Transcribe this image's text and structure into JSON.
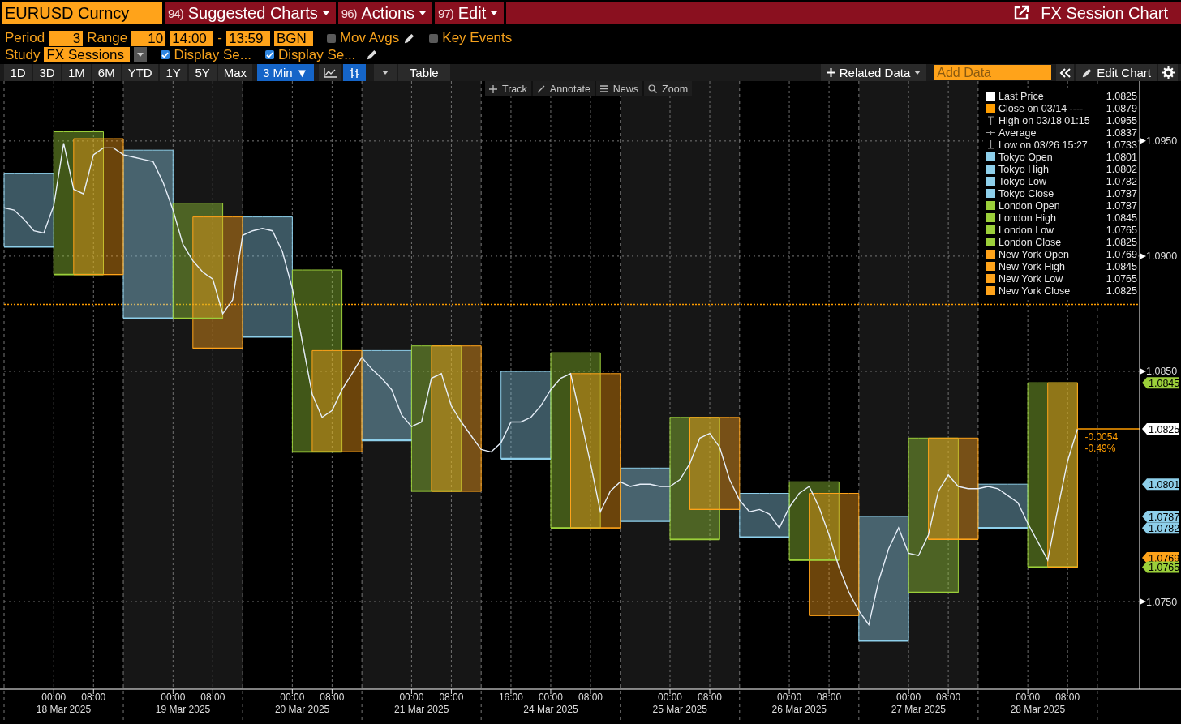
{
  "header": {
    "security": "EURUSD Curncy",
    "menus": [
      {
        "number": "94)",
        "label": "Suggested Charts"
      },
      {
        "number": "96)",
        "label": "Actions"
      },
      {
        "number": "97)",
        "label": "Edit"
      }
    ],
    "title": "FX Session Chart"
  },
  "settings": {
    "period_label": "Period",
    "period": "3",
    "range_label": "Range",
    "range": "10",
    "start": "14:00",
    "separator": "-",
    "end": "13:59",
    "mode": "BGN",
    "options": [
      {
        "kind": "editable",
        "label": "Mov Avgs",
        "checked": false
      },
      {
        "kind": "plain",
        "label": "Key Events",
        "checked": false
      }
    ]
  },
  "study": {
    "label": "Study",
    "value": "FX Sessions",
    "options": [
      {
        "label": "Display Se...",
        "checked": true
      },
      {
        "label": "Display Se...",
        "checked": true
      }
    ]
  },
  "toolbar": {
    "ranges": [
      {
        "label": "1D",
        "selected": false
      },
      {
        "label": "3D",
        "selected": false
      },
      {
        "label": "1M",
        "selected": false
      },
      {
        "label": "6M",
        "selected": false
      },
      {
        "label": "YTD",
        "selected": false
      },
      {
        "label": "1Y",
        "selected": false
      },
      {
        "label": "5Y",
        "selected": false
      },
      {
        "label": "Max",
        "selected": false
      }
    ],
    "frequency": "3 Min ▼",
    "chart_types": [
      {
        "kind": "line",
        "selected": false
      },
      {
        "kind": "bar",
        "selected": true
      }
    ],
    "table": "Table",
    "related": "Related Data",
    "add_data_placeholder": "Add Data",
    "edit_chart": "Edit Chart"
  },
  "chart_tools": [
    {
      "kind": "track",
      "label": "Track"
    },
    {
      "kind": "annotate",
      "label": "Annotate"
    },
    {
      "kind": "news",
      "label": "News"
    },
    {
      "kind": "zoom",
      "label": "Zoom"
    }
  ],
  "legend": [
    {
      "kind": "square",
      "label": "Last Price",
      "value": "1.0825",
      "color": "#ffffff"
    },
    {
      "kind": "square",
      "label": "Close on 03/14 ----",
      "value": "1.0879",
      "color": "#ff9d00"
    },
    {
      "kind": "high",
      "label": "High on 03/18 01:15",
      "value": "1.0955"
    },
    {
      "kind": "average",
      "label": "Average",
      "value": "1.0837"
    },
    {
      "kind": "low",
      "label": "Low on 03/26 15:27",
      "value": "1.0733"
    },
    {
      "kind": "square",
      "label": "Tokyo Open",
      "value": "1.0801",
      "color": "#8ecfea"
    },
    {
      "kind": "square",
      "label": "Tokyo High",
      "value": "1.0802",
      "color": "#8ecfea"
    },
    {
      "kind": "square",
      "label": "Tokyo Low",
      "value": "1.0782",
      "color": "#8ecfea"
    },
    {
      "kind": "square",
      "label": "Tokyo Close",
      "value": "1.0787",
      "color": "#8ecfea"
    },
    {
      "kind": "square",
      "label": "London Open",
      "value": "1.0787",
      "color": "#9bcf3a"
    },
    {
      "kind": "square",
      "label": "London High",
      "value": "1.0845",
      "color": "#9bcf3a"
    },
    {
      "kind": "square",
      "label": "London Low",
      "value": "1.0765",
      "color": "#9bcf3a"
    },
    {
      "kind": "square",
      "label": "London Close",
      "value": "1.0825",
      "color": "#9bcf3a"
    },
    {
      "kind": "square",
      "label": "New York Open",
      "value": "1.0769",
      "color": "#ffa31a"
    },
    {
      "kind": "square",
      "label": "New York High",
      "value": "1.0845",
      "color": "#ffa31a"
    },
    {
      "kind": "square",
      "label": "New York Low",
      "value": "1.0765",
      "color": "#ffa31a"
    },
    {
      "kind": "square",
      "label": "New York Close",
      "value": "1.0825",
      "color": "#ffa31a"
    }
  ],
  "chart": {
    "dates": [
      {
        "label": "18 Mar 2025",
        "shaded": false
      },
      {
        "label": "19 Mar 2025",
        "shaded": true
      },
      {
        "label": "20 Mar 2025",
        "shaded": false
      },
      {
        "label": "21 Mar 2025",
        "shaded": true
      },
      {
        "label": "24 Mar 2025",
        "shaded": false
      },
      {
        "label": "25 Mar 2025",
        "shaded": true
      },
      {
        "label": "26 Mar 2025",
        "shaded": false
      },
      {
        "label": "27 Mar 2025",
        "shaded": true
      },
      {
        "label": "28 Mar 2025",
        "shaded": false
      }
    ],
    "chart_data": {
      "type": "line",
      "grid": true,
      "ylim": [
        1.0712,
        1.0976
      ],
      "yticks": [
        {
          "value": 1.075,
          "label": "1.0750"
        },
        {
          "value": 1.085,
          "label": "1.0850"
        },
        {
          "value": 1.09,
          "label": "1.0900"
        },
        {
          "value": 1.095,
          "label": "1.0950"
        }
      ],
      "categories": [
        null,
        null,
        null,
        null,
        null,
        "00:00",
        null,
        null,
        null,
        "08:00",
        null,
        null,
        null,
        null,
        null,
        null,
        null,
        "00:00",
        null,
        null,
        null,
        "08:00",
        null,
        null,
        null,
        null,
        null,
        null,
        null,
        "00:00",
        null,
        null,
        null,
        "08:00",
        null,
        null,
        null,
        null,
        null,
        null,
        null,
        "00:00",
        null,
        null,
        null,
        "08:00",
        null,
        null,
        null,
        null,
        null,
        "16:00",
        null,
        null,
        null,
        "00:00",
        null,
        null,
        null,
        "08:00",
        null,
        null,
        null,
        null,
        null,
        null,
        null,
        "00:00",
        null,
        null,
        null,
        "08:00",
        null,
        null,
        null,
        null,
        null,
        null,
        null,
        "00:00",
        null,
        null,
        null,
        "08:00",
        null,
        null,
        null,
        null,
        null,
        null,
        null,
        "00:00",
        null,
        null,
        null,
        "08:00",
        null,
        null,
        null,
        null,
        null,
        null,
        null,
        "00:00",
        null,
        null,
        null,
        "08:00",
        null
      ],
      "series": [
        {
          "color": "#e6eef8",
          "values": [
            1.0921,
            1.092,
            1.0916,
            1.0911,
            1.091,
            1.0922,
            1.0949,
            1.0929,
            1.0927,
            1.0944,
            1.0947,
            1.0947,
            1.0944,
            1.0943,
            1.0942,
            1.0941,
            1.0932,
            1.092,
            1.0905,
            1.0898,
            1.0893,
            1.089,
            1.0875,
            1.0881,
            1.0909,
            1.0911,
            1.0912,
            1.0911,
            1.0902,
            1.0886,
            1.0863,
            1.084,
            1.083,
            1.0833,
            1.0842,
            1.0849,
            1.0856,
            1.0851,
            1.0847,
            1.0842,
            1.0831,
            1.0826,
            1.0828,
            1.0847,
            1.0849,
            1.0835,
            1.0828,
            1.0822,
            1.0816,
            1.0815,
            1.0819,
            1.0828,
            1.0828,
            1.083,
            1.0835,
            1.0842,
            1.0847,
            1.0849,
            1.083,
            1.081,
            1.0789,
            1.0798,
            1.0802,
            1.08,
            1.0801,
            1.0801,
            1.08,
            1.08,
            1.0803,
            1.081,
            1.0821,
            1.0823,
            1.0817,
            1.0803,
            1.0794,
            1.0789,
            1.079,
            1.0788,
            1.0782,
            1.0791,
            1.0797,
            1.08,
            1.0791,
            1.0779,
            1.0765,
            1.0754,
            1.0746,
            1.074,
            1.0759,
            1.0773,
            1.0782,
            1.0771,
            1.077,
            1.0779,
            1.0798,
            1.0805,
            1.08,
            1.0799,
            1.0799,
            1.08,
            1.0799,
            1.0796,
            1.0793,
            1.0784,
            1.0776,
            1.0768,
            1.079,
            1.0811,
            1.0825
          ]
        },
        {
          "type": "area",
          "color": "#8ecfea",
          "values": [
            1.0936,
            1.0936,
            1.0936,
            1.0936,
            1.0936,
            1.0936,
            null,
            null,
            null,
            null,
            null,
            null,
            1.0946,
            1.0946,
            1.0946,
            1.0946,
            1.0946,
            1.0946,
            null,
            null,
            null,
            null,
            null,
            null,
            1.0917,
            1.0917,
            1.0917,
            1.0917,
            1.0917,
            1.0917,
            null,
            null,
            null,
            null,
            null,
            null,
            1.0859,
            1.0859,
            1.0859,
            1.0859,
            1.0859,
            1.0859,
            null,
            null,
            null,
            null,
            null,
            null,
            null,
            null,
            1.085,
            1.085,
            1.085,
            1.085,
            1.085,
            1.085,
            null,
            null,
            null,
            null,
            null,
            null,
            1.0808,
            1.0808,
            1.0808,
            1.0808,
            1.0808,
            1.0808,
            null,
            null,
            null,
            null,
            null,
            null,
            1.0797,
            1.0797,
            1.0797,
            1.0797,
            1.0797,
            1.0797,
            null,
            null,
            null,
            null,
            null,
            null,
            1.0787,
            1.0787,
            1.0787,
            1.0787,
            1.0787,
            1.0787,
            null,
            null,
            null,
            null,
            null,
            null,
            1.0801,
            1.0801,
            1.0801,
            1.0801,
            1.0801,
            1.0801,
            null,
            null,
            null,
            null,
            null
          ]
        },
        {
          "type": "line",
          "color": "#8ecfea",
          "values": [
            1.0904,
            1.0904,
            1.0904,
            1.0904,
            1.0904,
            1.0904,
            null,
            null,
            null,
            null,
            null,
            null,
            1.0873,
            1.0873,
            1.0873,
            1.0873,
            1.0873,
            1.0873,
            null,
            null,
            null,
            null,
            null,
            null,
            1.0865,
            1.0865,
            1.0865,
            1.0865,
            1.0865,
            1.0865,
            null,
            null,
            null,
            null,
            null,
            null,
            1.082,
            1.082,
            1.082,
            1.082,
            1.082,
            1.082,
            null,
            null,
            null,
            null,
            null,
            null,
            null,
            null,
            1.0812,
            1.0812,
            1.0812,
            1.0812,
            1.0812,
            1.0812,
            null,
            null,
            null,
            null,
            null,
            null,
            1.0785,
            1.0785,
            1.0785,
            1.0785,
            1.0785,
            1.0785,
            null,
            null,
            null,
            null,
            null,
            null,
            1.0778,
            1.0778,
            1.0778,
            1.0778,
            1.0778,
            1.0778,
            null,
            null,
            null,
            null,
            null,
            null,
            1.0733,
            1.0733,
            1.0733,
            1.0733,
            1.0733,
            1.0733,
            null,
            null,
            null,
            null,
            null,
            null,
            1.0782,
            1.0782,
            1.0782,
            1.0782,
            1.0782,
            1.0782,
            null,
            null,
            null,
            null,
            null
          ]
        },
        {
          "type": "area",
          "color": "#9bcf3a",
          "values": [
            null,
            null,
            null,
            null,
            null,
            1.0954,
            1.0954,
            1.0954,
            1.0954,
            1.0954,
            1.0954,
            null,
            null,
            null,
            null,
            null,
            null,
            1.0923,
            1.0923,
            1.0923,
            1.0923,
            1.0923,
            1.0923,
            null,
            null,
            null,
            null,
            null,
            null,
            1.0894,
            1.0894,
            1.0894,
            1.0894,
            1.0894,
            1.0894,
            null,
            null,
            null,
            null,
            null,
            null,
            1.0861,
            1.0861,
            1.0861,
            1.0861,
            1.0861,
            1.0861,
            null,
            null,
            null,
            null,
            null,
            null,
            null,
            null,
            1.0858,
            1.0858,
            1.0858,
            1.0858,
            1.0858,
            1.0858,
            null,
            null,
            null,
            null,
            null,
            null,
            1.083,
            1.083,
            1.083,
            1.083,
            1.083,
            1.083,
            null,
            null,
            null,
            null,
            null,
            null,
            1.0802,
            1.0802,
            1.0802,
            1.0802,
            1.0802,
            1.0802,
            null,
            null,
            null,
            null,
            null,
            null,
            1.0821,
            1.0821,
            1.0821,
            1.0821,
            1.0821,
            1.0821,
            null,
            null,
            null,
            null,
            null,
            null,
            1.0845,
            1.0845,
            1.0845,
            1.0845,
            1.0845,
            1.0845
          ]
        },
        {
          "type": "line",
          "color": "#9bcf3a",
          "values": [
            null,
            null,
            null,
            null,
            null,
            1.0892,
            1.0892,
            1.0892,
            1.0892,
            1.0892,
            1.0892,
            null,
            null,
            null,
            null,
            null,
            null,
            1.0873,
            1.0873,
            1.0873,
            1.0873,
            1.0873,
            1.0873,
            null,
            null,
            null,
            null,
            null,
            null,
            1.0815,
            1.0815,
            1.0815,
            1.0815,
            1.0815,
            1.0815,
            null,
            null,
            null,
            null,
            null,
            null,
            1.0798,
            1.0798,
            1.0798,
            1.0798,
            1.0798,
            1.0798,
            null,
            null,
            null,
            null,
            null,
            null,
            null,
            null,
            1.0782,
            1.0782,
            1.0782,
            1.0782,
            1.0782,
            1.0782,
            null,
            null,
            null,
            null,
            null,
            null,
            1.0777,
            1.0777,
            1.0777,
            1.0777,
            1.0777,
            1.0777,
            null,
            null,
            null,
            null,
            null,
            null,
            1.0768,
            1.0768,
            1.0768,
            1.0768,
            1.0768,
            1.0768,
            null,
            null,
            null,
            null,
            null,
            null,
            1.0754,
            1.0754,
            1.0754,
            1.0754,
            1.0754,
            1.0754,
            null,
            null,
            null,
            null,
            null,
            null,
            1.0765,
            1.0765,
            1.0765,
            1.0765,
            1.0765,
            1.0765
          ]
        },
        {
          "type": "area",
          "color": "#ffa31a",
          "values": [
            null,
            null,
            null,
            null,
            null,
            null,
            null,
            1.0951,
            1.0951,
            1.0951,
            1.0951,
            1.0951,
            1.0951,
            null,
            null,
            null,
            null,
            null,
            null,
            1.0917,
            1.0917,
            1.0917,
            1.0917,
            1.0917,
            1.0917,
            null,
            null,
            null,
            null,
            null,
            null,
            1.0859,
            1.0859,
            1.0859,
            1.0859,
            1.0859,
            1.0859,
            null,
            null,
            null,
            null,
            null,
            null,
            1.0861,
            1.0861,
            1.0861,
            1.0861,
            1.0861,
            1.0861,
            null,
            null,
            null,
            null,
            null,
            null,
            null,
            null,
            1.0849,
            1.0849,
            1.0849,
            1.0849,
            1.0849,
            1.0849,
            null,
            null,
            null,
            null,
            null,
            null,
            1.083,
            1.083,
            1.083,
            1.083,
            1.083,
            1.083,
            null,
            null,
            null,
            null,
            null,
            null,
            1.0797,
            1.0797,
            1.0797,
            1.0797,
            1.0797,
            1.0797,
            null,
            null,
            null,
            null,
            null,
            null,
            1.0821,
            1.0821,
            1.0821,
            1.0821,
            1.0821,
            1.0821,
            null,
            null,
            null,
            null,
            null,
            null,
            1.0845,
            1.0845,
            1.0845,
            1.0845
          ]
        },
        {
          "type": "line",
          "color": "#ffa31a",
          "values": [
            null,
            null,
            null,
            null,
            null,
            null,
            null,
            1.0892,
            1.0892,
            1.0892,
            1.0892,
            1.0892,
            1.0892,
            null,
            null,
            null,
            null,
            null,
            null,
            1.086,
            1.086,
            1.086,
            1.086,
            1.086,
            1.086,
            null,
            null,
            null,
            null,
            null,
            null,
            1.0815,
            1.0815,
            1.0815,
            1.0815,
            1.0815,
            1.0815,
            null,
            null,
            null,
            null,
            null,
            null,
            1.0798,
            1.0798,
            1.0798,
            1.0798,
            1.0798,
            1.0798,
            null,
            null,
            null,
            null,
            null,
            null,
            null,
            null,
            1.0782,
            1.0782,
            1.0782,
            1.0782,
            1.0782,
            1.0782,
            null,
            null,
            null,
            null,
            null,
            null,
            1.079,
            1.079,
            1.079,
            1.079,
            1.079,
            1.079,
            null,
            null,
            null,
            null,
            null,
            null,
            1.0744,
            1.0744,
            1.0744,
            1.0744,
            1.0744,
            1.0744,
            null,
            null,
            null,
            null,
            null,
            null,
            1.0777,
            1.0777,
            1.0777,
            1.0777,
            1.0777,
            1.0777,
            null,
            null,
            null,
            null,
            null,
            null,
            1.0765,
            1.0765,
            1.0765,
            1.0765
          ]
        }
      ],
      "ref_lines": [
        {
          "axis": "y",
          "value": 1.0879,
          "color": "#ff9d00"
        }
      ],
      "annotations": [
        "-0.0054",
        "-0.49%"
      ]
    },
    "price_tags": [
      {
        "text": "1.0845",
        "color": "#9bcf3a"
      },
      {
        "text": "1.0825",
        "color": "#ffffff"
      },
      {
        "text": "1.0801",
        "color": "#8ecfea"
      },
      {
        "text": "1.0787",
        "color": "#8ecfea"
      },
      {
        "text": "1.0782",
        "color": "#8ecfea"
      },
      {
        "text": "1.0769",
        "color": "#ffa31a"
      },
      {
        "text": "1.0765",
        "color": "#9bcf3a"
      }
    ]
  }
}
